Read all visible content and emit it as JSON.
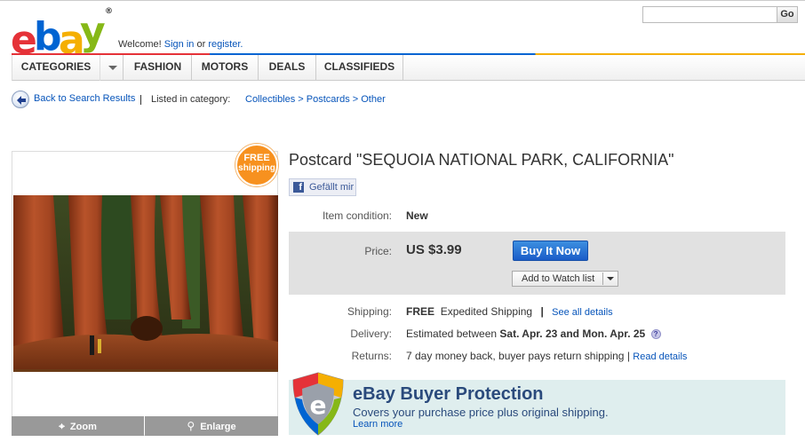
{
  "header": {
    "logo_letters": [
      "e",
      "b",
      "a",
      "y"
    ],
    "logo_reg": "®",
    "welcome_text": "Welcome!",
    "sign_in": "Sign in",
    "or_text": "or",
    "register": "register.",
    "search_placeholder": "",
    "go_label": "Go"
  },
  "nav": {
    "items": [
      "CATEGORIES",
      "FASHION",
      "MOTORS",
      "DEALS",
      "CLASSIFIEDS"
    ]
  },
  "breadcrumb": {
    "back_label": "Back to Search Results",
    "listed_in": "Listed in category:",
    "path": "Collectibles > Postcards > Other"
  },
  "image_panel": {
    "badge_line1": "FREE",
    "badge_line2": "shipping",
    "zoom_label": "Zoom",
    "enlarge_label": "Enlarge"
  },
  "item": {
    "title": "Postcard \"SEQUOIA NATIONAL PARK, CALIFORNIA\"",
    "fb_like": "Gefällt mir",
    "condition_label": "Item condition:",
    "condition_value": "New",
    "price_label": "Price:",
    "price_value": "US $3.99",
    "buy_now": "Buy It Now",
    "watch_list": "Add to Watch list",
    "shipping_label": "Shipping:",
    "shipping_free": "FREE",
    "shipping_method": "Expedited Shipping",
    "shipping_details": "See all details",
    "delivery_label": "Delivery:",
    "delivery_text": "Estimated between",
    "delivery_range": "Sat. Apr. 23 and Mon. Apr. 25",
    "returns_label": "Returns:",
    "returns_text": "7 day money back, buyer pays return shipping",
    "returns_details": "Read details"
  },
  "protection": {
    "title": "eBay Buyer Protection",
    "subtitle": "Covers your purchase price plus original shipping.",
    "learn_more": "Learn more",
    "shield_letter": "e"
  },
  "colors": {
    "ebay_red": "#e53238",
    "ebay_blue": "#0064d2",
    "ebay_yellow": "#f5af02",
    "ebay_green": "#86b817",
    "link": "#0654ba",
    "badge_orange": "#f7911f",
    "buy_button": "#1b5cc8"
  }
}
